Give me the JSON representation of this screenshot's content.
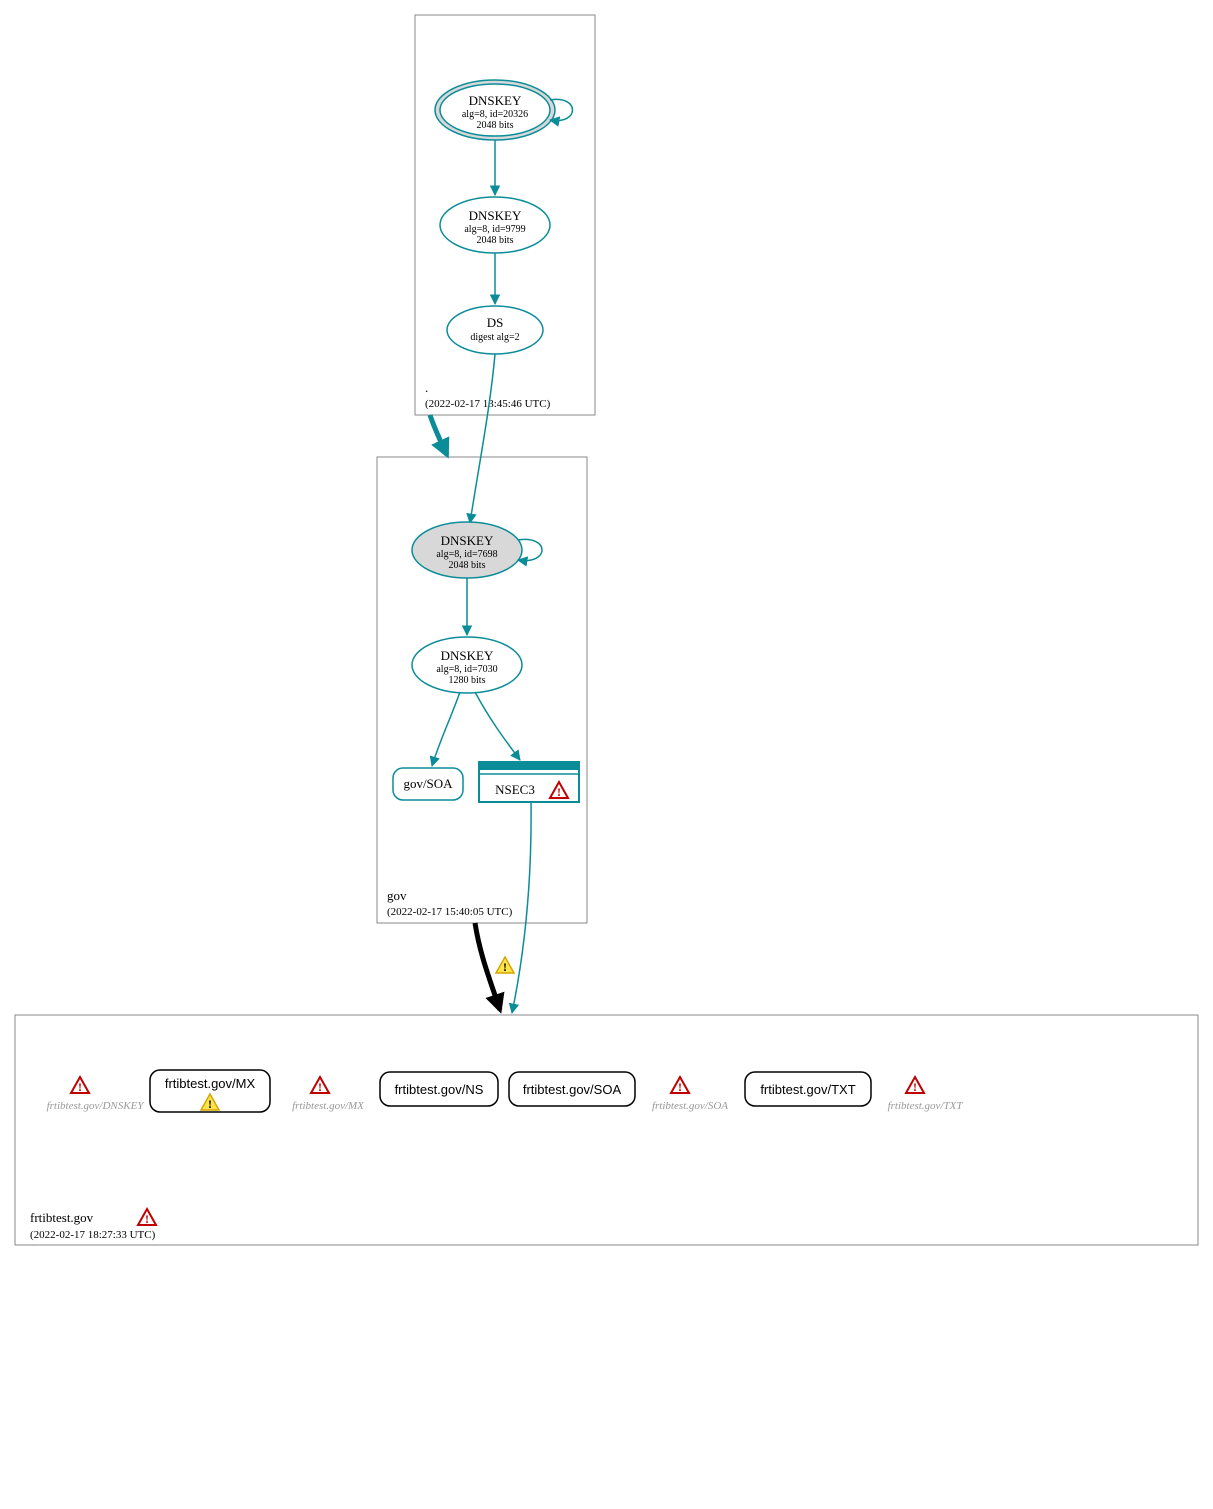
{
  "zones": {
    "root": {
      "name": ".",
      "timestamp": "(2022-02-17 13:45:46 UTC)"
    },
    "gov": {
      "name": "gov",
      "timestamp": "(2022-02-17 15:40:05 UTC)"
    },
    "frtibtest": {
      "name": "frtibtest.gov",
      "timestamp": "(2022-02-17 18:27:33 UTC)"
    }
  },
  "nodes": {
    "root_ksk": {
      "title": "DNSKEY",
      "line1": "alg=8, id=20326",
      "line2": "2048 bits"
    },
    "root_zsk": {
      "title": "DNSKEY",
      "line1": "alg=8, id=9799",
      "line2": "2048 bits"
    },
    "root_ds": {
      "title": "DS",
      "line1": "digest alg=2"
    },
    "gov_ksk": {
      "title": "DNSKEY",
      "line1": "alg=8, id=7698",
      "line2": "2048 bits"
    },
    "gov_zsk": {
      "title": "DNSKEY",
      "line1": "alg=8, id=7030",
      "line2": "1280 bits"
    },
    "gov_soa": {
      "label": "gov/SOA"
    },
    "gov_nsec3": {
      "label": "NSEC3"
    }
  },
  "records": {
    "dnskey_err": "frtibtest.gov/DNSKEY",
    "mx": "frtibtest.gov/MX",
    "mx_err": "frtibtest.gov/MX",
    "ns": "frtibtest.gov/NS",
    "soa": "frtibtest.gov/SOA",
    "soa_err": "frtibtest.gov/SOA",
    "txt": "frtibtest.gov/TXT",
    "txt_err": "frtibtest.gov/TXT"
  }
}
